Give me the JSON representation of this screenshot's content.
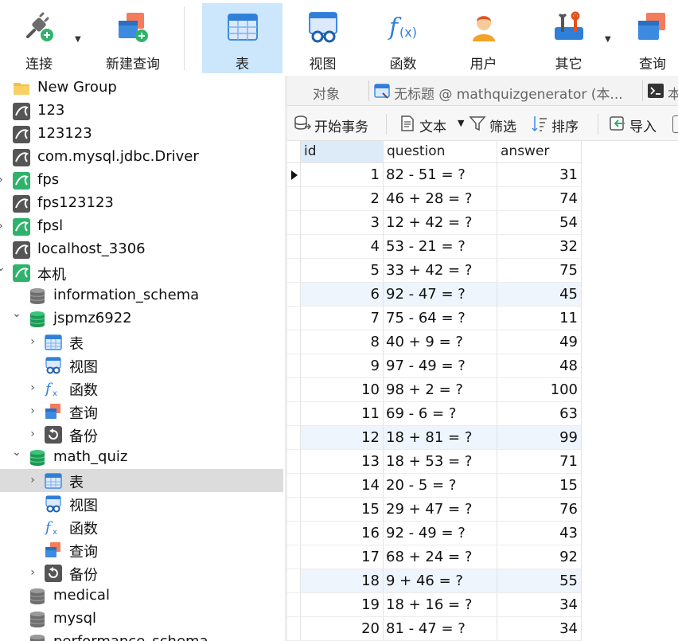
{
  "toolbar": {
    "buttons": [
      {
        "label": "连接",
        "icon": "plug-connect-icon"
      },
      {
        "label": "新建查询",
        "icon": "new-query-icon"
      },
      {
        "label": "表",
        "icon": "table-icon"
      },
      {
        "label": "视图",
        "icon": "view-icon"
      },
      {
        "label": "函数",
        "icon": "function-icon"
      },
      {
        "label": "用户",
        "icon": "user-icon"
      },
      {
        "label": "其它",
        "icon": "tools-icon"
      },
      {
        "label": "查询",
        "icon": "query-icon"
      }
    ],
    "active": "表"
  },
  "tree": {
    "items": [
      {
        "label": "New Group",
        "icon": "folder-icon"
      },
      {
        "label": "123",
        "icon": "mysql-connection-icon"
      },
      {
        "label": "123123",
        "icon": "mysql-connection-icon"
      },
      {
        "label": "com.mysql.jdbc.Driver",
        "icon": "mysql-connection-icon"
      },
      {
        "label": "fps",
        "icon": "mysql-connection-active-icon"
      },
      {
        "label": "fps123123",
        "icon": "mysql-connection-icon"
      },
      {
        "label": "fpsl",
        "icon": "mysql-connection-active-icon"
      },
      {
        "label": "localhost_3306",
        "icon": "mysql-connection-icon"
      },
      {
        "label": "本机",
        "icon": "mysql-connection-active-icon"
      },
      {
        "label": "information_schema",
        "icon": "database-icon"
      },
      {
        "label": "jspmz6922",
        "icon": "database-open-icon"
      },
      {
        "label": "表",
        "icon": "table-icon"
      },
      {
        "label": "视图",
        "icon": "view-icon"
      },
      {
        "label": "函数",
        "icon": "function-icon"
      },
      {
        "label": "查询",
        "icon": "query-icon"
      },
      {
        "label": "备份",
        "icon": "backup-icon"
      },
      {
        "label": "math_quiz",
        "icon": "database-open-icon"
      },
      {
        "label": "表",
        "icon": "table-icon"
      },
      {
        "label": "视图",
        "icon": "view-icon"
      },
      {
        "label": "函数",
        "icon": "function-icon"
      },
      {
        "label": "查询",
        "icon": "query-icon"
      },
      {
        "label": "备份",
        "icon": "backup-icon"
      },
      {
        "label": "medical",
        "icon": "database-icon"
      },
      {
        "label": "mysql",
        "icon": "database-icon"
      },
      {
        "label": "performance_schema",
        "icon": "database-icon"
      }
    ],
    "selected": "math_quiz > 表"
  },
  "tabs": {
    "objects": "对象",
    "doc_title": "无标题 @ mathquizgenerator (本...",
    "console_partial": "本"
  },
  "subtoolbar": {
    "begin_transaction": "开始事务",
    "text": "文本",
    "filter": "筛选",
    "sort": "排序",
    "import": "导入"
  },
  "grid": {
    "columns": [
      "id",
      "question",
      "answer"
    ],
    "rows": [
      [
        "1",
        "82 - 51 = ?",
        "31"
      ],
      [
        "2",
        "46 + 28 = ?",
        "74"
      ],
      [
        "3",
        "12 + 42 = ?",
        "54"
      ],
      [
        "4",
        "53 - 21 = ?",
        "32"
      ],
      [
        "5",
        "33 + 42 = ?",
        "75"
      ],
      [
        "6",
        "92 - 47 = ?",
        "45"
      ],
      [
        "7",
        "75 - 64 = ?",
        "11"
      ],
      [
        "8",
        "40 + 9 = ?",
        "49"
      ],
      [
        "9",
        "97 - 49 = ?",
        "48"
      ],
      [
        "10",
        "98 + 2 = ?",
        "100"
      ],
      [
        "11",
        "69 - 6 = ?",
        "63"
      ],
      [
        "12",
        "18 + 81 = ?",
        "99"
      ],
      [
        "13",
        "18 + 53 = ?",
        "71"
      ],
      [
        "14",
        "20 - 5 = ?",
        "15"
      ],
      [
        "15",
        "29 + 47 = ?",
        "76"
      ],
      [
        "16",
        "92 - 49 = ?",
        "43"
      ],
      [
        "17",
        "68 + 24 = ?",
        "92"
      ],
      [
        "18",
        "9 + 46 = ?",
        "55"
      ],
      [
        "19",
        "18 + 16 = ?",
        "34"
      ],
      [
        "20",
        "81 - 47 = ?",
        "34"
      ]
    ]
  }
}
